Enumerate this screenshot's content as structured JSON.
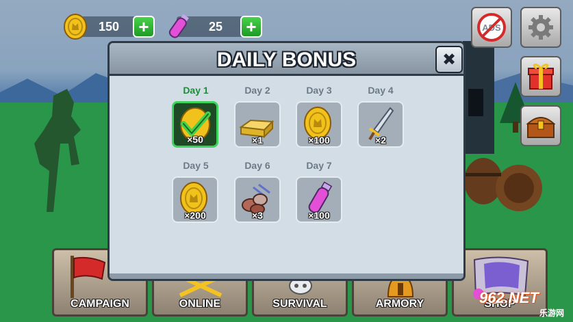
{
  "resources": {
    "coins": "150",
    "potions": "25",
    "coin_icon": "gold-coin-icon",
    "potion_icon": "potion-vial-icon",
    "plus_symbol": "+"
  },
  "side_buttons": [
    {
      "icon": "no-ads-icon",
      "label": "ADS"
    },
    {
      "icon": "gear-icon"
    },
    {
      "icon": "gift-box-icon"
    },
    {
      "icon": "treasure-chest-icon"
    }
  ],
  "menu": [
    {
      "label": "CAMPAIGN",
      "icon": "red-flag-icon"
    },
    {
      "label": "ONLINE",
      "icon": "crossed-swords-icon"
    },
    {
      "label": "SURVIVAL",
      "icon": "skull-icon"
    },
    {
      "label": "ARMORY",
      "icon": "helmet-icon"
    },
    {
      "label": "SHOP",
      "icon": "scroll-icon"
    }
  ],
  "daily_bonus": {
    "title": "DAILY BONUS",
    "close_symbol": "✖",
    "days": [
      {
        "label": "Day 1",
        "count": "×50",
        "reward": "coin",
        "claimed": true
      },
      {
        "label": "Day 2",
        "count": "×1",
        "reward": "gold-bar",
        "claimed": false
      },
      {
        "label": "Day 3",
        "count": "×100",
        "reward": "coin",
        "claimed": false
      },
      {
        "label": "Day 4",
        "count": "×2",
        "reward": "sword",
        "claimed": false
      },
      {
        "label": "Day 5",
        "count": "×200",
        "reward": "coin",
        "claimed": false
      },
      {
        "label": "Day 6",
        "count": "×3",
        "reward": "stones",
        "claimed": false
      },
      {
        "label": "Day 7",
        "count": "×100",
        "reward": "potion",
        "claimed": false
      }
    ]
  },
  "watermark": {
    "main": "962.NET",
    "sub": "乐游网"
  },
  "colors": {
    "accent_green": "#3cd35a",
    "coin_gold": "#f1c21b",
    "potion_pink": "#e34fd6",
    "shop_red": "#d42a2a"
  }
}
